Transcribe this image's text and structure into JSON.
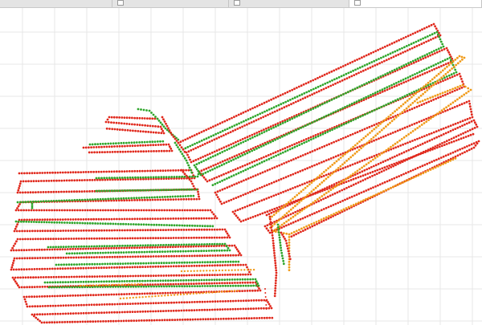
{
  "tabs": [
    {
      "label": "",
      "active": false
    },
    {
      "label": "",
      "active": false
    },
    {
      "label": "",
      "active": false
    },
    {
      "label": "",
      "active": true
    }
  ],
  "map": {
    "background": "#ffffff",
    "grid_color": "#e7e7e7",
    "track_colors": {
      "red": "#e0281c",
      "green": "#2ea62b",
      "orange": "#f09a18"
    }
  }
}
